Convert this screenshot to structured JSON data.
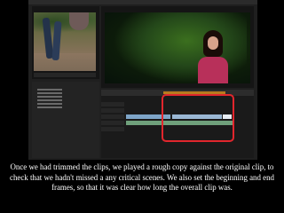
{
  "caption": {
    "line1": "Once we had trimmed the clips, we played  a rough copy against the original clip, to",
    "line2": "check that we hadn't missed a any critical scenes. We also set the beginning and end",
    "line3": "frames, so that it was clear how long the overall clip was."
  },
  "colors": {
    "background": "#000000",
    "caption_text": "#ffffff",
    "highlight_box": "#e1262d",
    "panel_background": "#1f1f1f",
    "video_clip": "#7ea5c8",
    "audio_clip": "#6fa07b",
    "work_area_bar": "#b87b1e"
  },
  "icons": [
    "play-icon",
    "stop-icon"
  ]
}
